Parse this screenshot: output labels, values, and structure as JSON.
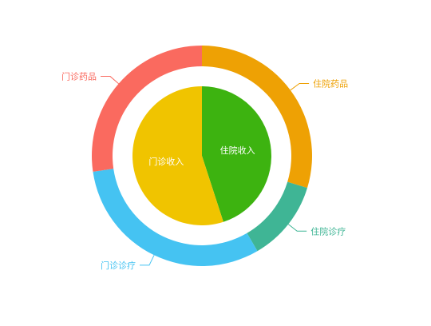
{
  "chart_data": {
    "type": "pie",
    "inner_series": {
      "kind": "pie",
      "slices": [
        {
          "name": "住院收入",
          "value": 45,
          "color": "#3db310"
        },
        {
          "name": "门诊收入",
          "value": 55,
          "color": "#f0c400"
        }
      ]
    },
    "outer_series": {
      "kind": "donut",
      "slices": [
        {
          "name": "住院药品",
          "value": 29.7,
          "color": "#eea104"
        },
        {
          "name": "住院诊疗",
          "value": 11.9,
          "color": "#3fb595"
        },
        {
          "name": "门诊诊疗",
          "value": 31.1,
          "color": "#45c3f2"
        },
        {
          "name": "门诊药品",
          "value": 27.3,
          "color": "#fa6a5f"
        }
      ]
    },
    "start_angle": "top",
    "direction": "clockwise",
    "legend": "none"
  }
}
